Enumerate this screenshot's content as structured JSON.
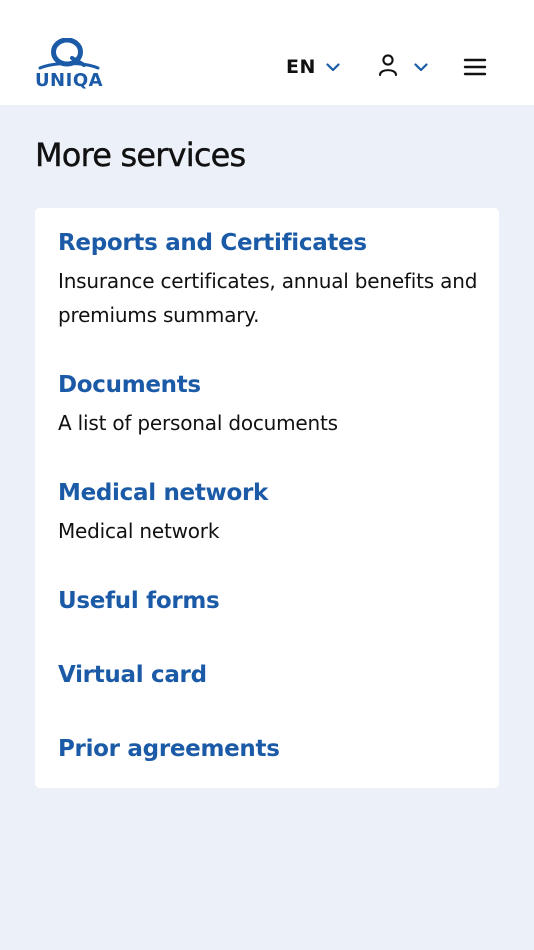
{
  "header": {
    "logo_text": "UNIQA",
    "language": "EN",
    "icons": {
      "language_chevron": "chevron-down-icon",
      "user": "user-icon",
      "user_chevron": "chevron-down-icon",
      "menu": "hamburger-menu-icon"
    }
  },
  "main": {
    "title": "More services",
    "services": [
      {
        "title": "Reports and Certificates",
        "description": "Insurance certificates, annual benefits and premiums summary."
      },
      {
        "title": "Documents",
        "description": "A list of personal documents"
      },
      {
        "title": "Medical network",
        "description": "Medical network"
      },
      {
        "title": "Useful forms"
      },
      {
        "title": "Virtual card"
      },
      {
        "title": "Prior agreements"
      }
    ]
  },
  "colors": {
    "brand_blue": "#1b5aa6",
    "background": "#ecf0f9",
    "card": "#ffffff",
    "text": "#111111"
  }
}
